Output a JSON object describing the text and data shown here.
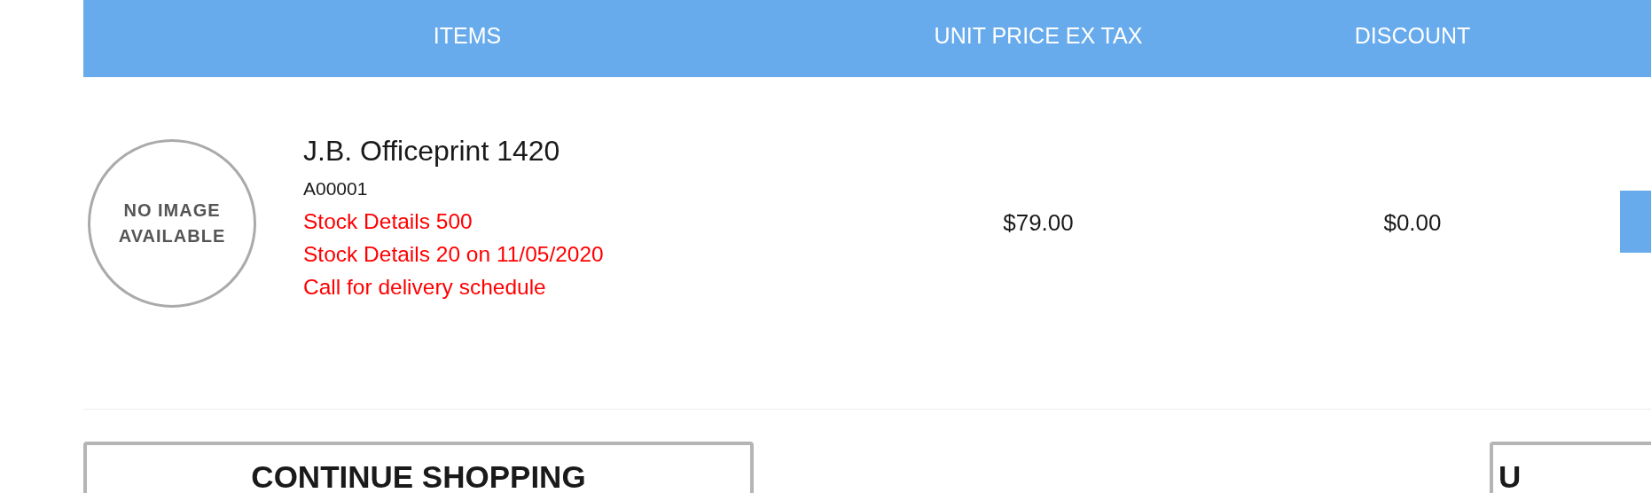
{
  "table": {
    "columns": [
      "ITEMS",
      "UNIT PRICE EX TAX",
      "DISCOUNT"
    ],
    "rows": [
      {
        "image_text": [
          "NO IMAGE",
          "AVAILABLE"
        ],
        "name": "J.B. Officeprint 1420",
        "code": "A00001",
        "notes": [
          "Stock Details 500",
          "Stock Details 20 on 11/05/2020",
          "Call for delivery schedule"
        ],
        "unit_price": "$79.00",
        "discount": "$0.00"
      }
    ]
  },
  "buttons": [
    {
      "label": "CONTINUE SHOPPING"
    },
    {
      "label": "U"
    }
  ]
}
